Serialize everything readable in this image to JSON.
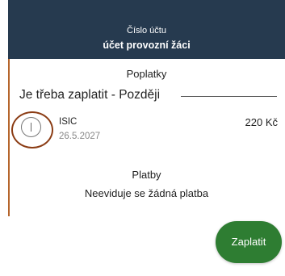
{
  "account": {
    "label": "Číslo účtu",
    "name": "účet provozní žáci"
  },
  "fees": {
    "title": "Poplatky",
    "status": "Je třeba zaplatit - Později",
    "items": [
      {
        "name": "ISIC",
        "date": "26.5.2027",
        "amount": "220 Kč",
        "icon": "pending-status-icon"
      }
    ]
  },
  "payments": {
    "title": "Platby",
    "empty_text": "Neeviduje se žádná platba"
  },
  "actions": {
    "pay_label": "Zaplatit"
  },
  "colors": {
    "header_bg": "#263a4f",
    "accent_border": "#b5652c",
    "highlight_ring": "#8b3c14",
    "pay_button": "#2e7d32"
  }
}
